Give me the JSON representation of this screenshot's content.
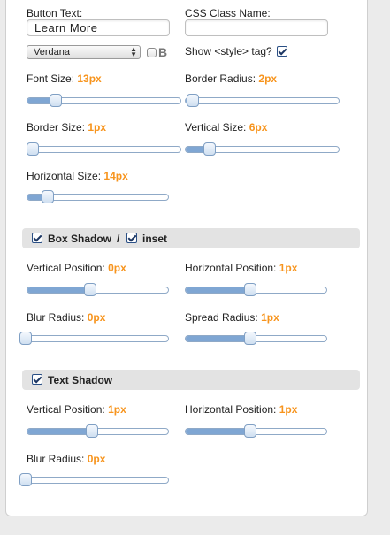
{
  "button_text": {
    "label": "Button Text:",
    "value": "Learn More"
  },
  "css_class": {
    "label": "CSS Class Name:",
    "value": ""
  },
  "font_select": {
    "value": "Verdana"
  },
  "bold_toggle": {
    "label": "B",
    "checked": false
  },
  "show_style": {
    "label": "Show <style> tag?",
    "checked": true
  },
  "font_size": {
    "label": "Font Size:",
    "value": "13px",
    "fraction": 0.19
  },
  "border_radius": {
    "label": "Border Radius:",
    "value": "2px",
    "fraction": 0.05
  },
  "border_size": {
    "label": "Border Size:",
    "value": "1px",
    "fraction": 0.03
  },
  "vertical_size": {
    "label": "Vertical Size:",
    "value": "6px",
    "fraction": 0.16
  },
  "horizontal_size": {
    "label": "Horizontal Size:",
    "value": "14px",
    "fraction": 0.15
  },
  "box_shadow": {
    "title": "Box Shadow",
    "separator": "/",
    "inset_label": "inset",
    "enabled": true,
    "inset": true,
    "vertical_position": {
      "label": "Vertical Position:",
      "value": "0px",
      "fraction": 0.45
    },
    "horizontal_position": {
      "label": "Horizontal Position:",
      "value": "1px",
      "fraction": 0.46
    },
    "blur_radius": {
      "label": "Blur Radius:",
      "value": "0px",
      "fraction": 0.0
    },
    "spread_radius": {
      "label": "Spread Radius:",
      "value": "1px",
      "fraction": 0.46
    }
  },
  "text_shadow": {
    "title": "Text Shadow",
    "enabled": true,
    "vertical_position": {
      "label": "Vertical Position:",
      "value": "1px",
      "fraction": 0.46
    },
    "horizontal_position": {
      "label": "Horizontal Position:",
      "value": "1px",
      "fraction": 0.46
    },
    "blur_radius": {
      "label": "Blur Radius:",
      "value": "0px",
      "fraction": 0.0
    }
  }
}
